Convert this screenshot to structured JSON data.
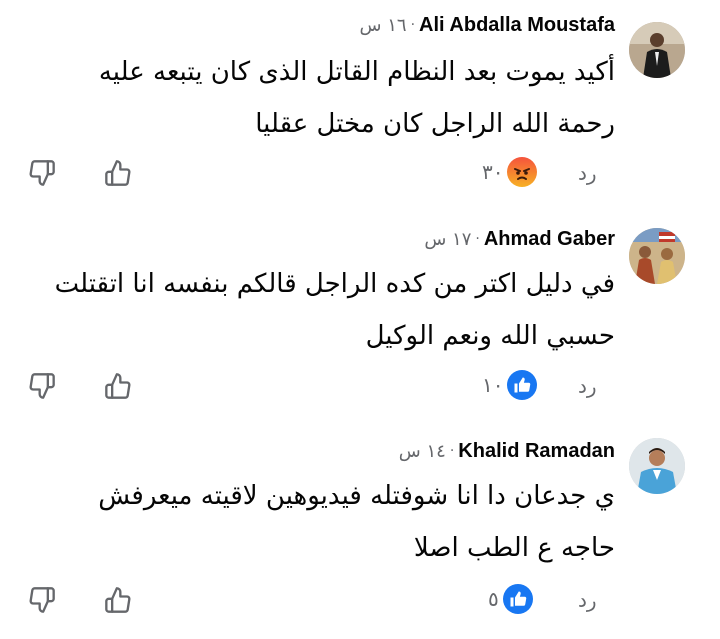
{
  "comments": [
    {
      "author": "Ali Abdalla Moustafa",
      "time": "١٦ س",
      "dot": "·",
      "lines": [
        "أكيد يموت بعد النظام القاتل الذى كان يتبعه عليه",
        "رحمة  الله الراجل كان مختل عقليا"
      ],
      "reply_label": "رد",
      "reaction_icon": "angry-reaction-icon",
      "reaction_count": "٣٠"
    },
    {
      "author": "Ahmad Gaber",
      "time": "١٧ س",
      "dot": "·",
      "lines": [
        "في دليل اكتر من كده الراجل قالكم بنفسه انا اتقتلت",
        "حسبي الله ونعم الوكيل"
      ],
      "reply_label": "رد",
      "reaction_icon": "like-reaction-icon",
      "reaction_count": "١٠"
    },
    {
      "author": "Khalid Ramadan",
      "time": "١٤ س",
      "dot": "·",
      "lines": [
        "ي جدعان دا انا شوفتله فيديوهين لاقيته ميعرفش",
        "حاجه ع الطب اصلا"
      ],
      "reply_label": "رد",
      "reaction_icon": "like-reaction-icon",
      "reaction_count": "٥"
    }
  ],
  "colors": {
    "like_blue": "#1877f2",
    "angry_start": "#f5533d",
    "angry_end": "#f7b125",
    "meta_gray": "#65676b"
  }
}
